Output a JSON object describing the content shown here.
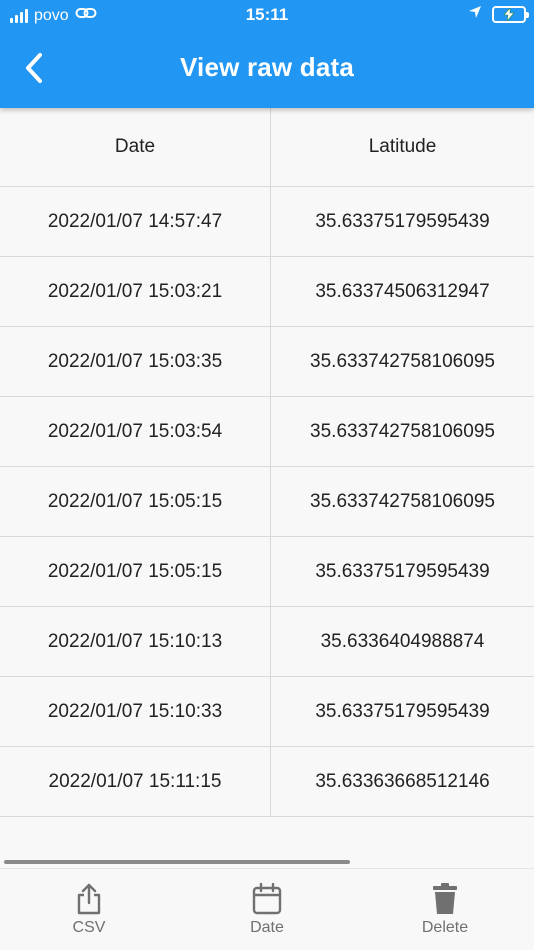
{
  "status_bar": {
    "carrier": "povo",
    "time": "15:11"
  },
  "app_bar": {
    "title": "View raw data",
    "back_icon": "chevron-left-icon"
  },
  "table": {
    "columns": [
      "Date",
      "Latitude"
    ],
    "rows": [
      [
        "2022/01/07 14:57:47",
        "35.63375179595439"
      ],
      [
        "2022/01/07 15:03:21",
        "35.63374506312947"
      ],
      [
        "2022/01/07 15:03:35",
        "35.633742758106095"
      ],
      [
        "2022/01/07 15:03:54",
        "35.633742758106095"
      ],
      [
        "2022/01/07 15:05:15",
        "35.633742758106095"
      ],
      [
        "2022/01/07 15:05:15",
        "35.63375179595439"
      ],
      [
        "2022/01/07 15:10:13",
        "35.6336404988874"
      ],
      [
        "2022/01/07 15:10:33",
        "35.63375179595439"
      ],
      [
        "2022/01/07 15:11:15",
        "35.63363668512146"
      ]
    ]
  },
  "bottom_bar": {
    "csv_label": "CSV",
    "date_label": "Date",
    "delete_label": "Delete"
  },
  "colors": {
    "primary": "#2196f3",
    "battery": "#4cd964"
  }
}
